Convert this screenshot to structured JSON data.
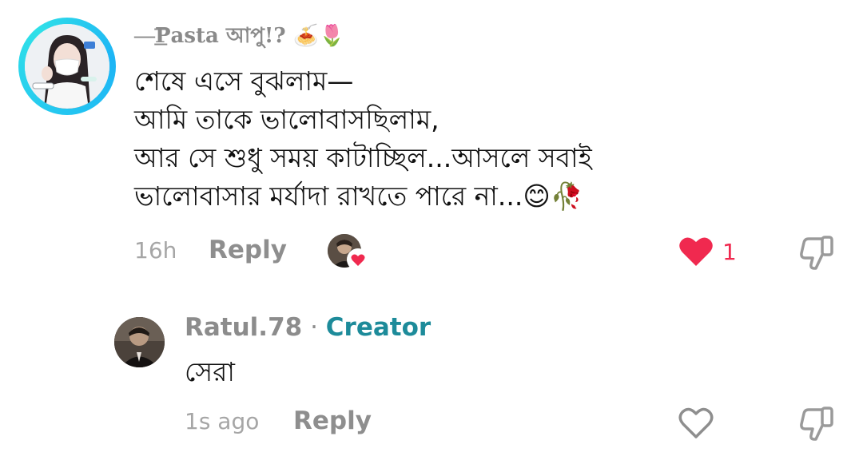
{
  "comment": {
    "username": "—͟͟͞͞𝐏𝐚𝐬𝐭𝐚 আপু!? 🍝🌷",
    "lines": [
      "শেষে এসে বুঝলাম—",
      "আমি তাকে ভালোবাসছিলাম,",
      "আর সে শুধু সময় কাটাচ্ছিল...আসলে সবাই",
      "ভালোবাসার মর্যাদা রাখতে পারে না...😊🥀"
    ],
    "time": "16h",
    "reply_label": "Reply",
    "like_count": "1",
    "liked": true
  },
  "reply": {
    "username": "Ratul.78",
    "separator": " · ",
    "badge": "Creator",
    "text": "সেরা",
    "time": "1s ago",
    "reply_label": "Reply",
    "liked": false
  },
  "colors": {
    "like_red": "#f0294f",
    "creator_teal": "#1d8b9a",
    "meta_gray": "#8e8e8e",
    "avatar_ring": "#25c9f0"
  },
  "icons": {
    "like": "heart-icon",
    "dislike": "thumbs-down-icon",
    "creator_liked": "small-heart-icon"
  }
}
